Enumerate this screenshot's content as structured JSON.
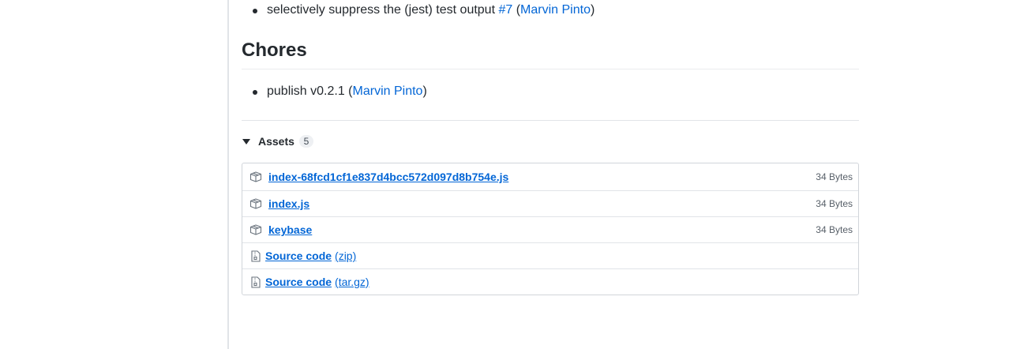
{
  "fixes": {
    "items": [
      {
        "text": "selectively suppress the (jest) test output ",
        "ref": "#7",
        "open_paren": " (",
        "author": "Marvin Pinto",
        "close_paren": ")"
      }
    ]
  },
  "chores": {
    "heading": "Chores",
    "items": [
      {
        "text": "publish v0.2.1 (",
        "author": "Marvin Pinto",
        "close_paren": ")"
      }
    ]
  },
  "assets": {
    "title": "Assets",
    "count": "5",
    "files": [
      {
        "name": "index-68fcd1cf1e837d4bcc572d097d8b754e.js",
        "size": "34 Bytes",
        "icon": "package-icon"
      },
      {
        "name": "index.js",
        "size": "34 Bytes",
        "icon": "package-icon"
      },
      {
        "name": "keybase",
        "size": "34 Bytes",
        "icon": "package-icon"
      }
    ],
    "sources": [
      {
        "name": "Source code",
        "format": "(zip)",
        "icon": "file-zip-icon"
      },
      {
        "name": "Source code",
        "format": "(tar.gz)",
        "icon": "file-zip-icon"
      }
    ]
  },
  "colors": {
    "link": "#0366d6",
    "text": "#24292e",
    "muted": "#586069",
    "border": "#e1e4e8"
  }
}
